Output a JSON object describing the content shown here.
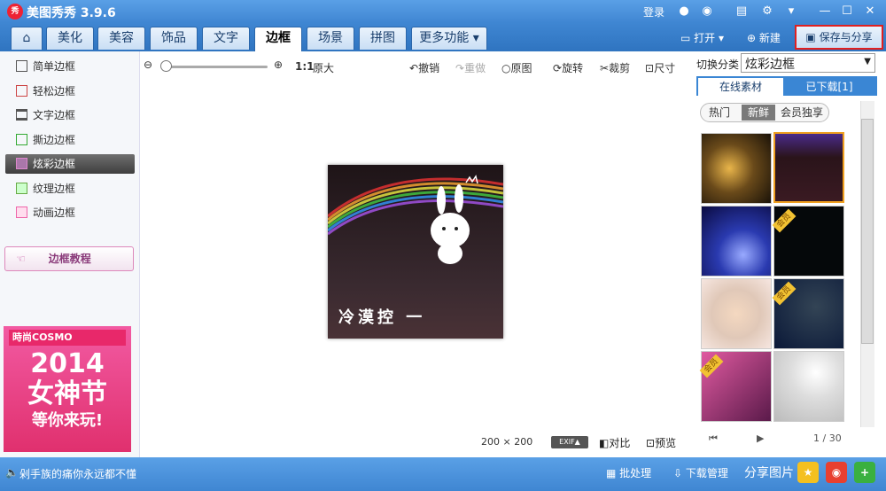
{
  "app": {
    "title": "美图秀秀 3.9.6",
    "logo": "秀"
  },
  "titlebar": {
    "login": "登录"
  },
  "tabs": [
    "美化",
    "美容",
    "饰品",
    "文字",
    "边框",
    "场景",
    "拼图",
    "更多功能 ▾"
  ],
  "toolbar_right": {
    "open": "打开",
    "new": "新建",
    "save_share": "保存与分享"
  },
  "sidebar": {
    "items": [
      "简单边框",
      "轻松边框",
      "文字边框",
      "撕边边框",
      "炫彩边框",
      "纹理边框",
      "动画边框"
    ],
    "selected": "炫彩边框",
    "tutorial": "边框教程"
  },
  "ad": {
    "brand": "時尚COSMO",
    "year": "2014",
    "line1": "女神节",
    "line2": "等你来玩!"
  },
  "edit_toolbar": {
    "zoom_label": "1:1",
    "original_size": "原大",
    "undo": "撤销",
    "redo": "重做",
    "original": "原图",
    "rotate": "旋转",
    "crop": "裁剪",
    "size": "尺寸"
  },
  "canvas": {
    "caption": "冷漠控 一"
  },
  "bottom": {
    "dimensions": "200 × 200",
    "exif": "EXIF▲",
    "compare": "对比",
    "preview": "预览"
  },
  "right": {
    "category_label": "切换分类",
    "category_value": "炫彩边框",
    "tab_online": "在线素材",
    "tab_downloaded": "已下载[1]",
    "filters": [
      "热门",
      "新鲜",
      "会员独享"
    ],
    "active_filter": "新鲜",
    "vip_badge": "会员",
    "pager": "1 / 30"
  },
  "statusbar": {
    "message": "剁手族的痛你永远都不懂",
    "batch": "批处理",
    "download": "下载管理",
    "share": "分享图片"
  },
  "colors": {
    "accent": "#3f86d2",
    "selection": "#e02020",
    "thumb_border": "#f0a020"
  }
}
